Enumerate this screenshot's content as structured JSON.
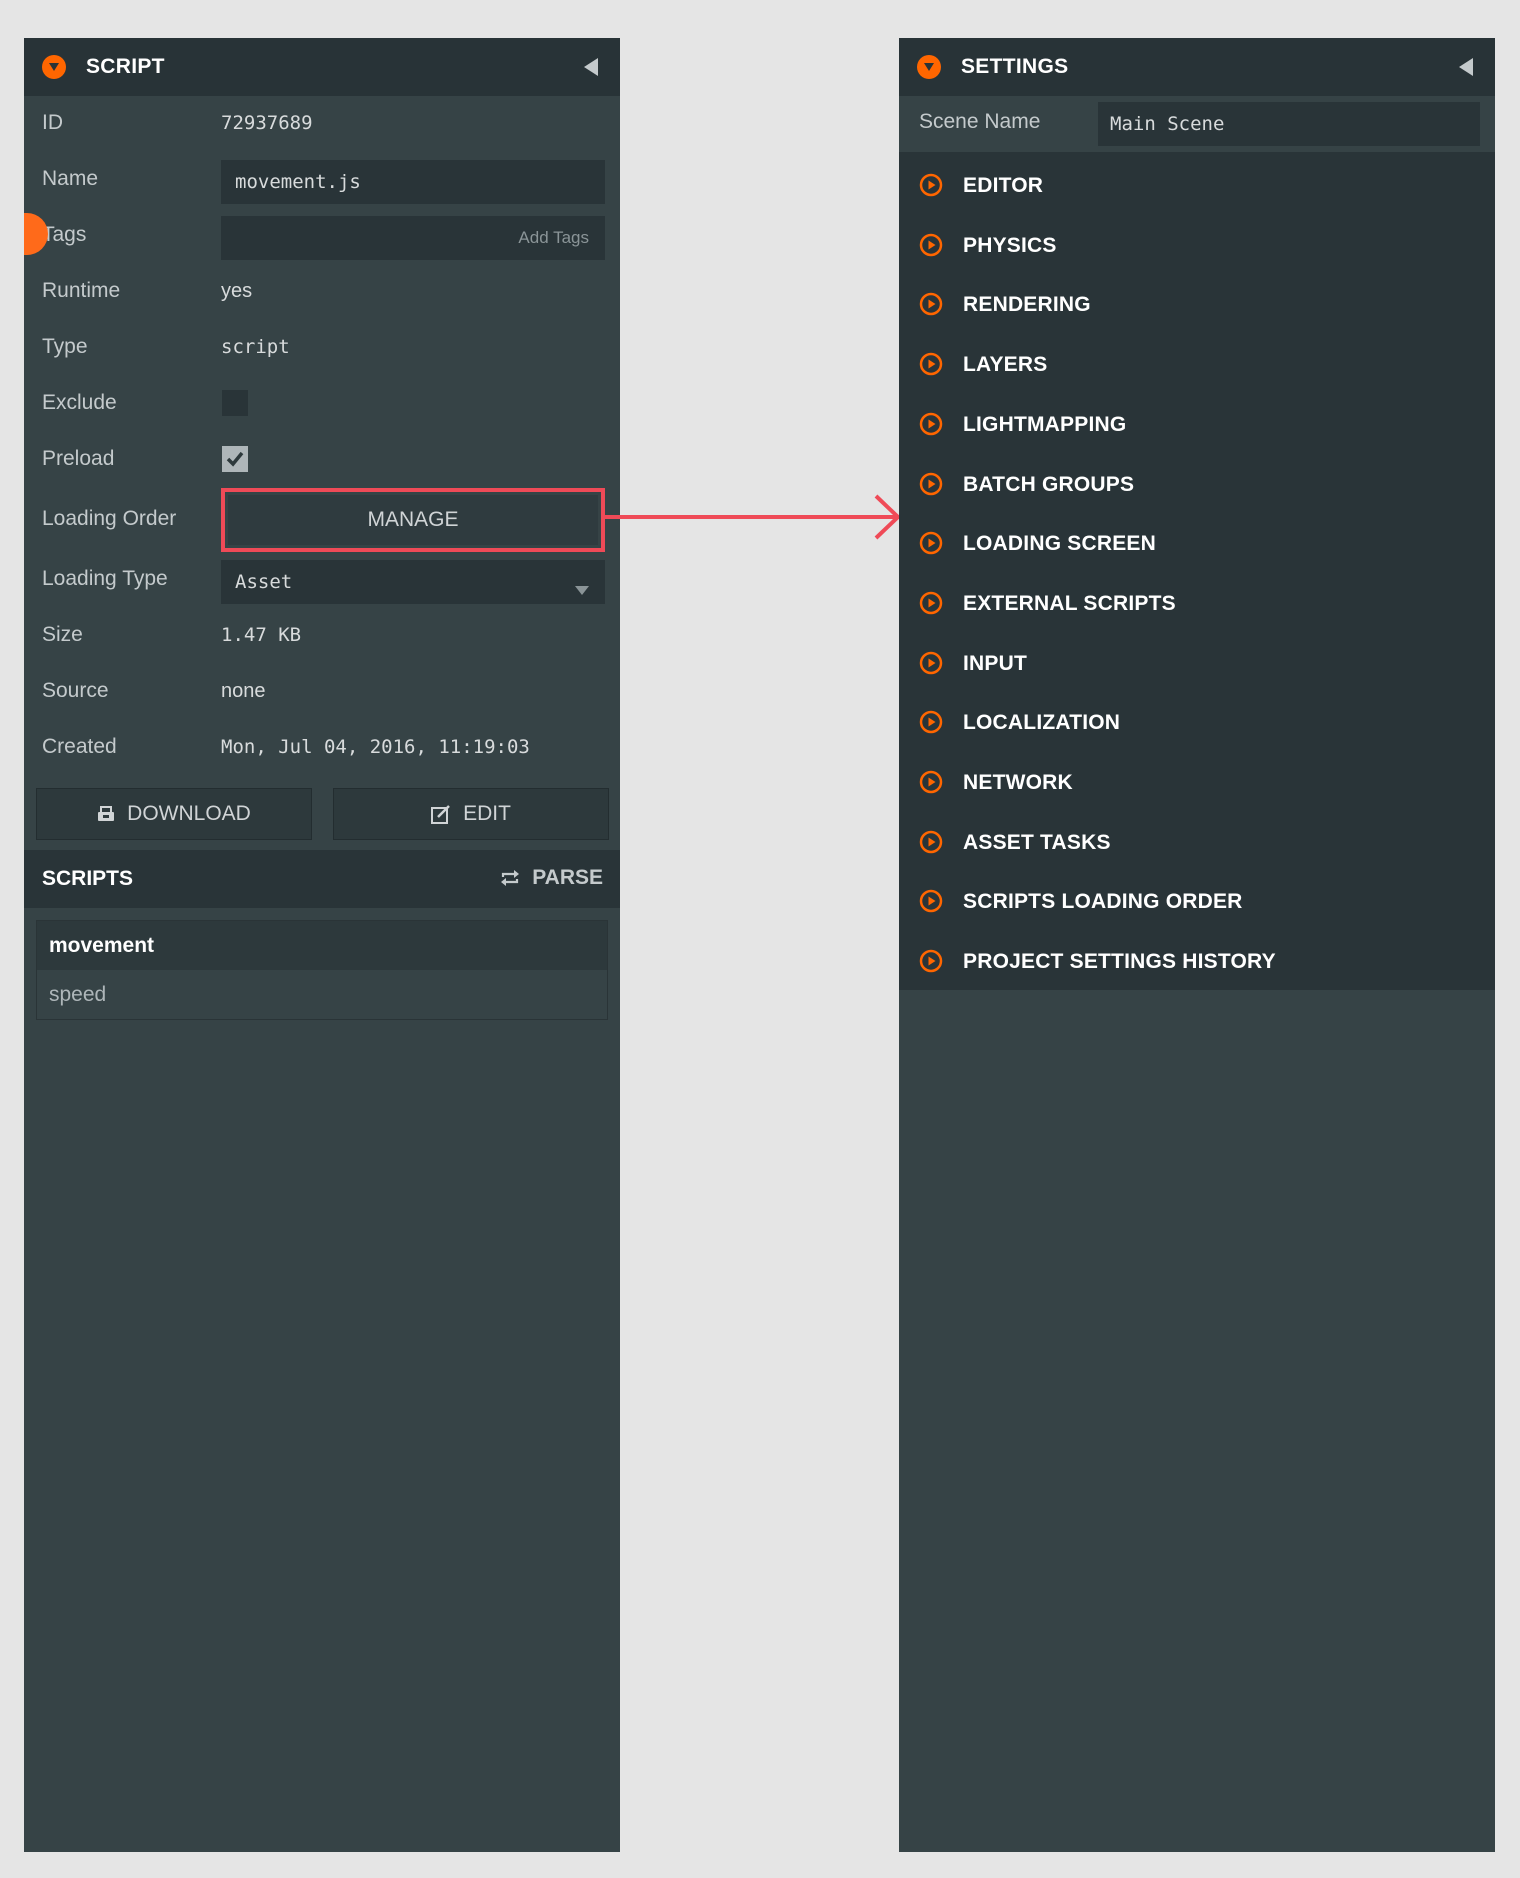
{
  "script_panel": {
    "title": "SCRIPT",
    "fields": {
      "id": {
        "label": "ID",
        "value": "72937689"
      },
      "name": {
        "label": "Name",
        "value": "movement.js"
      },
      "tags": {
        "label": "Tags",
        "placeholder": "Add Tags"
      },
      "runtime": {
        "label": "Runtime",
        "value": "yes"
      },
      "type": {
        "label": "Type",
        "value": "script"
      },
      "exclude": {
        "label": "Exclude",
        "checked": false
      },
      "preload": {
        "label": "Preload",
        "checked": true
      },
      "loading_order": {
        "label": "Loading Order",
        "button": "MANAGE"
      },
      "loading_type": {
        "label": "Loading Type",
        "value": "Asset"
      },
      "size": {
        "label": "Size",
        "value": "1.47 KB"
      },
      "source": {
        "label": "Source",
        "value": "none"
      },
      "created": {
        "label": "Created",
        "value": "Mon, Jul 04, 2016, 11:19:03"
      }
    },
    "download_label": "DOWNLOAD",
    "edit_label": "EDIT",
    "scripts_section": {
      "title": "SCRIPTS",
      "parse_label": "PARSE",
      "items": [
        {
          "name": "movement",
          "attributes": [
            "speed"
          ]
        }
      ]
    }
  },
  "settings_panel": {
    "title": "SETTINGS",
    "scene_name": {
      "label": "Scene Name",
      "value": "Main Scene"
    },
    "items": [
      "EDITOR",
      "PHYSICS",
      "RENDERING",
      "LAYERS",
      "LIGHTMAPPING",
      "BATCH GROUPS",
      "LOADING SCREEN",
      "EXTERNAL SCRIPTS",
      "INPUT",
      "LOCALIZATION",
      "NETWORK",
      "ASSET TASKS",
      "SCRIPTS LOADING ORDER",
      "PROJECT SETTINGS HISTORY"
    ]
  },
  "colors": {
    "accent": "#ff6600",
    "highlight": "#ef4a57",
    "panel_bg": "#364346",
    "header_bg": "#283337",
    "page_bg": "#e5e5e5"
  }
}
